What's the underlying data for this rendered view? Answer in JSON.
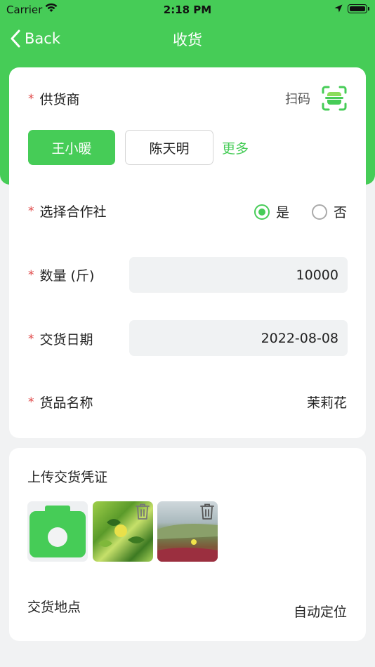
{
  "status_bar": {
    "carrier": "Carrier",
    "time": "2:18 PM"
  },
  "nav": {
    "back_label": "Back",
    "title": "收货"
  },
  "supplier": {
    "required_mark": "*",
    "label": "供货商",
    "scan_label": "扫码",
    "options": [
      "王小暖",
      "陈天明"
    ],
    "selected": "王小暖",
    "more_label": "更多"
  },
  "cooperative": {
    "required_mark": "*",
    "label": "选择合作社",
    "options": [
      "是",
      "否"
    ],
    "selected": "是"
  },
  "quantity": {
    "required_mark": "*",
    "label": "数量 (斤)",
    "value": "10000"
  },
  "delivery_date": {
    "required_mark": "*",
    "label": "交货日期",
    "value": "2022-08-08"
  },
  "product_name": {
    "required_mark": "*",
    "label": "货品名称",
    "value": "茉莉花"
  },
  "upload": {
    "title": "上传交货凭证",
    "location_label": "交货地点",
    "location_value": "自动定位"
  },
  "colors": {
    "accent": "#46cc57",
    "required": "#e04848",
    "input_bg": "#f0f2f3",
    "page_bg": "#f1f2f3"
  },
  "icons": {
    "scan": "scan-icon",
    "camera": "camera-icon",
    "delete": "trash-icon",
    "back": "chevron-left-icon"
  }
}
